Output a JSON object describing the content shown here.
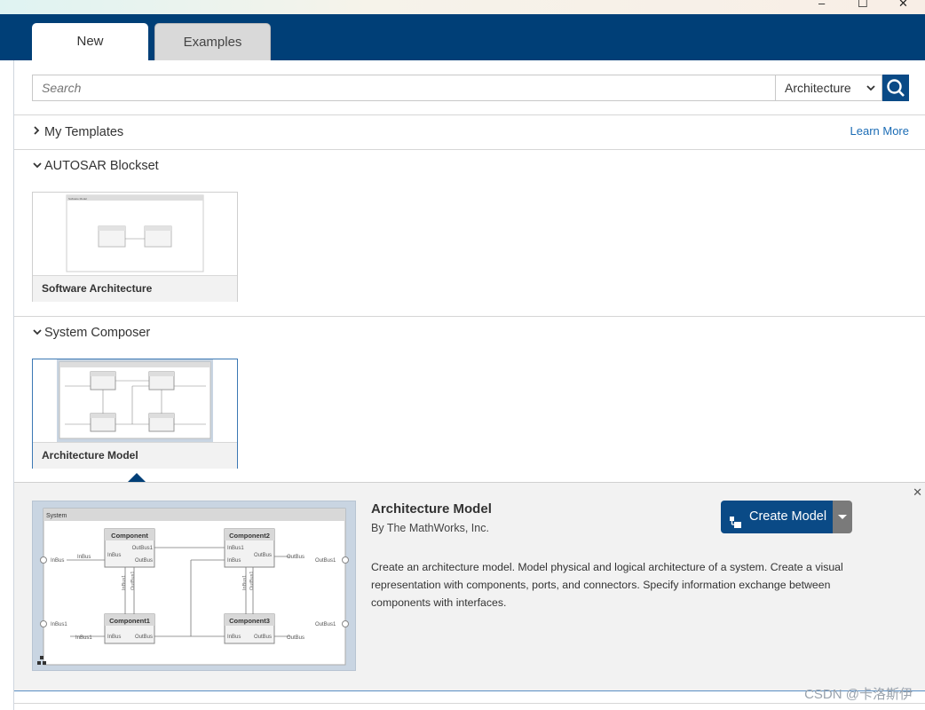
{
  "window": {
    "minimize": "–",
    "maximize": "☐",
    "close": "✕"
  },
  "tabs": [
    {
      "label": "New",
      "active": true
    },
    {
      "label": "Examples",
      "active": false
    }
  ],
  "search": {
    "placeholder": "Search",
    "value": "",
    "filter_selected": "Architecture"
  },
  "sections": {
    "my_templates": {
      "title": "My Templates",
      "expanded": false,
      "learn_more": "Learn More"
    },
    "autosar": {
      "title": "AUTOSAR Blockset",
      "expanded": true,
      "cards": [
        {
          "label": "Software Architecture",
          "thumb_title": "Software Model"
        }
      ]
    },
    "system_composer": {
      "title": "System Composer",
      "expanded": true,
      "cards": [
        {
          "label": "Architecture Model",
          "selected": true
        }
      ]
    }
  },
  "detail": {
    "title": "Architecture Model",
    "author": "By The MathWorks, Inc.",
    "description": "Create an architecture model. Model physical and logical architecture of a system. Create a visual representation with components, ports, and connectors. Specify information exchange between components with interfaces.",
    "create_label": "Create Model",
    "close": "✕",
    "preview": {
      "title": "System",
      "components": [
        "Component",
        "Component2",
        "Component1",
        "Component3"
      ],
      "ports": {
        "in_bus": "InBus",
        "out_bus": "OutBus",
        "in_bus1": "InBus1",
        "out_bus1": "OutBus1"
      }
    }
  },
  "watermark": "CSDN @卡洛斯伊",
  "colors": {
    "header": "#003f77",
    "accent": "#0a4a86",
    "link": "#1b6cb5"
  }
}
